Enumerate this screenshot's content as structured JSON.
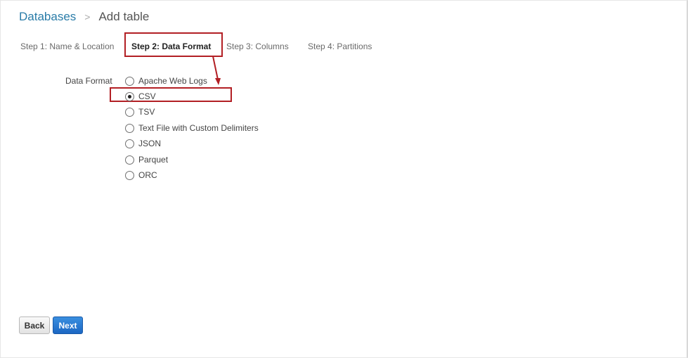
{
  "breadcrumb": {
    "root": "Databases",
    "separator": ">",
    "current": "Add table"
  },
  "steps": [
    {
      "label": "Step 1: Name & Location",
      "active": false
    },
    {
      "label": "Step 2: Data Format",
      "active": true
    },
    {
      "label": "Step 3: Columns",
      "active": false
    },
    {
      "label": "Step 4: Partitions",
      "active": false
    }
  ],
  "form": {
    "label": "Data Format",
    "selected": "CSV",
    "options": [
      "Apache Web Logs",
      "CSV",
      "TSV",
      "Text File with Custom Delimiters",
      "JSON",
      "Parquet",
      "ORC"
    ]
  },
  "buttons": {
    "back": "Back",
    "next": "Next"
  },
  "colors": {
    "link": "#2a7ca8",
    "highlight": "#b21f24",
    "primary": "#1c67c3"
  }
}
